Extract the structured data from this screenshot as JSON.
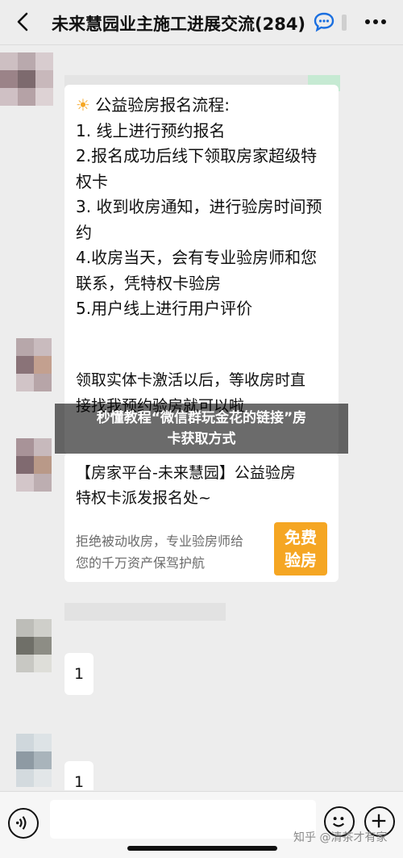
{
  "header": {
    "title": "未来慧园业主施工进展交流(284)",
    "back_icon": "chevron-left-icon",
    "more_icon": "more-dots-icon"
  },
  "messages": {
    "process_card": {
      "lines": [
        "公益验房报名流程:",
        "1.  线上进行预约报名",
        "2.报名成功后线下领取房家超级特",
        "权卡",
        "3.  收到收房通知，进行验房时间预",
        "约",
        "4.收房当天，会有专业验房师和您",
        "联系，凭特权卡验房",
        "5.用户线上进行用户评价"
      ]
    },
    "activation_card": {
      "lines": [
        "领取实体卡激活以后，等收房时直",
        "接找我预约验房就可以啦"
      ]
    },
    "link_card": {
      "title_lines": [
        "【房家平台-未来慧园】公益验房",
        "特权卡派发报名处~"
      ],
      "desc_lines": [
        "拒绝被动收房，专业验房师给",
        "您的千万资产保驾护航"
      ],
      "badge": "免费验房"
    },
    "small_1": "1",
    "small_2": "1"
  },
  "overlay": {
    "lines": [
      "秒懂教程“微信群玩金花的链接”房",
      "卡获取方式"
    ]
  },
  "input_bar": {
    "voice_icon": "voice-icon",
    "emoji_icon": "emoji-icon",
    "plus_icon": "plus-icon"
  },
  "watermark": "知乎 @清茶才有家",
  "colors": {
    "badge": "#f5a623",
    "background": "#ededed"
  }
}
